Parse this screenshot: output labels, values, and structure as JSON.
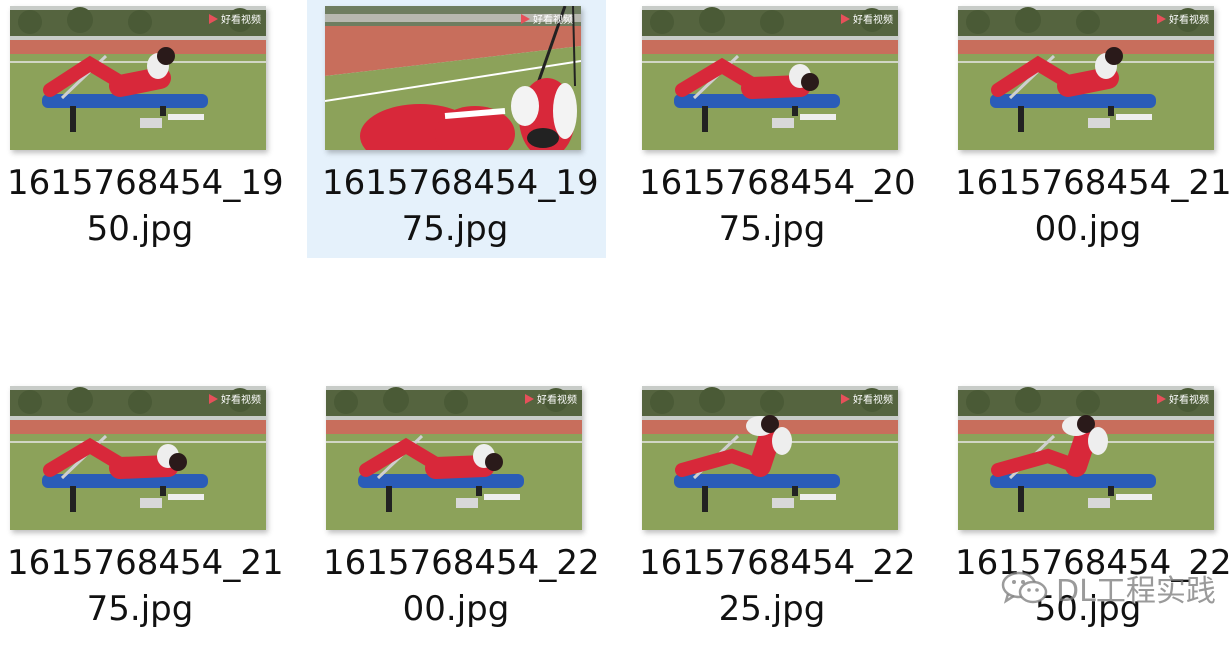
{
  "files": [
    {
      "name": "1615768454_19\n50.jpg",
      "selected": false,
      "pose": "lying-hands-head",
      "close_up": false
    },
    {
      "name": "1615768454_19\n75.jpg",
      "selected": true,
      "pose": "close-up",
      "close_up": true
    },
    {
      "name": "1615768454_20\n75.jpg",
      "selected": false,
      "pose": "lying-flat",
      "close_up": false
    },
    {
      "name": "1615768454_21\n00.jpg",
      "selected": false,
      "pose": "lying-hands-head",
      "close_up": false
    },
    {
      "name": "1615768454_21\n75.jpg",
      "selected": false,
      "pose": "lying-flat",
      "close_up": false
    },
    {
      "name": "1615768454_22\n00.jpg",
      "selected": false,
      "pose": "lying-flat",
      "close_up": false
    },
    {
      "name": "1615768454_22\n25.jpg",
      "selected": false,
      "pose": "sit-up",
      "close_up": false
    },
    {
      "name": "1615768454_22\n50.jpg",
      "selected": false,
      "pose": "sit-up",
      "close_up": false
    }
  ],
  "thumbnail_overlay_text": "好看视频",
  "watermark": {
    "text": "DL工程实践",
    "icon": "wechat-icon"
  },
  "colors": {
    "selection": "#e5f1fb",
    "grass": "#8ca25a",
    "track": "#c86e5c",
    "tracksuit": "#d8283a",
    "bench": "#2a5cb8"
  }
}
